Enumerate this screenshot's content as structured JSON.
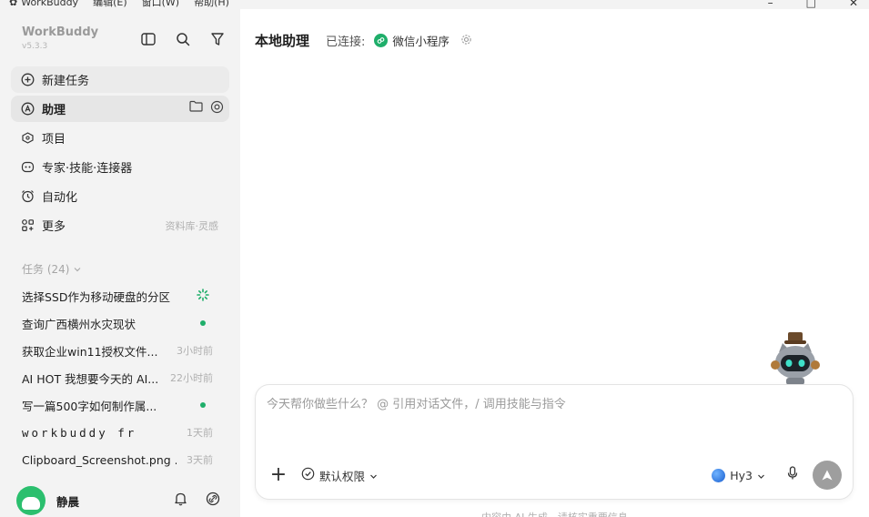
{
  "menubar": {
    "app_name": "WorkBuddy",
    "menus": [
      "编辑(E)",
      "窗口(W)",
      "帮助(H)"
    ],
    "controls": [
      "–",
      "□",
      "✕"
    ]
  },
  "sidebar": {
    "brand": "WorkBuddy",
    "version": "v5.3.3",
    "nav": [
      {
        "label": "新建任务",
        "icon": "plus-circle-icon"
      },
      {
        "label": "助理",
        "icon": "assistant-icon"
      },
      {
        "label": "项目",
        "icon": "project-icon"
      },
      {
        "label": "专家·技能·连接器",
        "icon": "expert-icon"
      },
      {
        "label": "自动化",
        "icon": "alarm-icon"
      },
      {
        "label": "更多",
        "icon": "grid-icon",
        "hint": "资料库·灵感"
      }
    ],
    "tasks_header": "任务 (24)",
    "tasks": [
      {
        "title": "选择SSD作为移动硬盘的分区",
        "status": "running"
      },
      {
        "title": "查询广西横州水灾现状",
        "status": "done"
      },
      {
        "title": "获取企业win11授权文件...",
        "time": "3小时前"
      },
      {
        "title": "AI HOT 我想要今天的 AI...",
        "time": "22小时前"
      },
      {
        "title": "写一篇500字如何制作属...",
        "status": "done"
      },
      {
        "title": "workbuddy fr",
        "time": "1天前"
      },
      {
        "title": "Clipboard_Screenshot.png ...",
        "time": "3天前"
      }
    ],
    "user_name": "静晨"
  },
  "main": {
    "title": "本地助理",
    "connected_label": "已连接:",
    "connected_app": "微信小程序",
    "composer": {
      "placeholder": "今天帮你做些什么？ @ 引用对话文件，/ 调用技能与指令",
      "permission": "默认权限",
      "model": "Hy3"
    },
    "footer": "内容由 AI 生成，请核实重要信息"
  },
  "colors": {
    "accent_green": "#1fae6a",
    "sidebar_bg": "#f3f3f3"
  }
}
